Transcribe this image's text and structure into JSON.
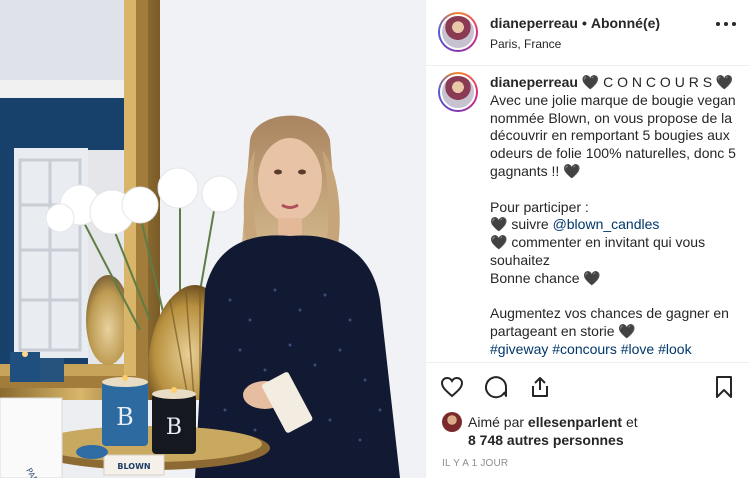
{
  "post": {
    "header": {
      "username": "dianeperreau",
      "separator": "•",
      "follow_status": "Abonné(e)",
      "location": "Paris, France",
      "avatar_icon": "profile-avatar-icon",
      "more_icon": "more-options-icon"
    },
    "caption": {
      "username": "dianeperreau",
      "title": "🖤 C O N C O U R S 🖤",
      "intro": "Avec une jolie marque de bougie vegan nommée Blown, on vous propose de la découvrir en remportant 5 bougies aux odeurs de folie 100% naturelles, donc 5 gagnants !! 🖤",
      "participate": "Pour participer :",
      "step1_prefix": "🖤 suivre ",
      "step1_mention": "@blown_candles",
      "step2": "🖤 commenter en invitant qui vous souhaitez",
      "good_luck": "Bonne chance 🖤",
      "chances": "Augmentez vos chances de gagner en partageant en storie 🖤",
      "hashtags": "#giveway #concours #love #look"
    },
    "actions": {
      "like_icon": "heart-icon",
      "comment_icon": "comment-icon",
      "share_icon": "share-icon",
      "save_icon": "bookmark-icon"
    },
    "likes": {
      "prefix": "Aimé par",
      "liker": "ellesenparlent",
      "connector": "et",
      "others": "8 748 autres personnes"
    },
    "timestamp": "IL Y A 1 JOUR"
  },
  "photo": {
    "candle_brand": "BLOWN",
    "box_text": "BLOWN",
    "box_small": "PARIS"
  },
  "colors": {
    "text": "#262626",
    "link": "#00376b",
    "muted": "#8e8e8e",
    "divider": "#efefef",
    "wall_blue": "#17416b",
    "sweater": "#121a33"
  }
}
